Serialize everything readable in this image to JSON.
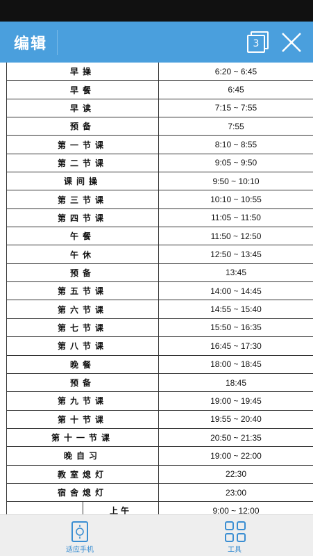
{
  "app_bar": {
    "title": "编辑",
    "page_count": "3"
  },
  "schedule": {
    "rows": [
      {
        "name": "早操",
        "time": "6:20 ~ 6:45"
      },
      {
        "name": "早餐",
        "time": "6:45"
      },
      {
        "name": "早读",
        "time": "7:15 ~ 7:55"
      },
      {
        "name": "预备",
        "time": "7:55"
      },
      {
        "name": "第一节课",
        "time": "8:10 ~ 8:55"
      },
      {
        "name": "第二节课",
        "time": "9:05 ~ 9:50"
      },
      {
        "name": "课间操",
        "time": "9:50 ~ 10:10"
      },
      {
        "name": "第三节课",
        "time": "10:10 ~ 10:55"
      },
      {
        "name": "第四节课",
        "time": "11:05 ~ 11:50"
      },
      {
        "name": "午餐",
        "time": "11:50 ~ 12:50"
      },
      {
        "name": "午休",
        "time": "12:50 ~ 13:45"
      },
      {
        "name": "预备",
        "time": "13:45"
      },
      {
        "name": "第五节课",
        "time": "14:00 ~ 14:45"
      },
      {
        "name": "第六节课",
        "time": "14:55 ~ 15:40"
      },
      {
        "name": "第七节课",
        "time": "15:50 ~ 16:35"
      },
      {
        "name": "第八节课",
        "time": "16:45 ~ 17:30"
      },
      {
        "name": "晚餐",
        "time": "18:00 ~ 18:45"
      },
      {
        "name": "预备",
        "time": "18:45"
      },
      {
        "name": "第九节课",
        "time": "19:00 ~ 19:45"
      },
      {
        "name": "第十节课",
        "time": "19:55 ~ 20:40"
      },
      {
        "name": "第十一节课",
        "time": "20:50 ~ 21:35"
      },
      {
        "name": "晚自习",
        "time": "19:00 ~ 22:00"
      },
      {
        "name": "教室熄灯",
        "time": "22:30"
      },
      {
        "name": "宿舍熄灯",
        "time": "23:00"
      }
    ],
    "split_row": {
      "name": "上午",
      "time": "9:00 ~ 12:00"
    }
  },
  "bottom_bar": {
    "fit_label": "适应手机",
    "tools_label": "工具"
  },
  "colors": {
    "app_bar": "#4a9fdd",
    "accent": "#3a8ed2",
    "status_bar": "#111111"
  },
  "icons": {
    "page": "pages-icon",
    "close": "close-icon",
    "fit": "fit-phone-icon",
    "tools": "tools-grid-icon"
  }
}
